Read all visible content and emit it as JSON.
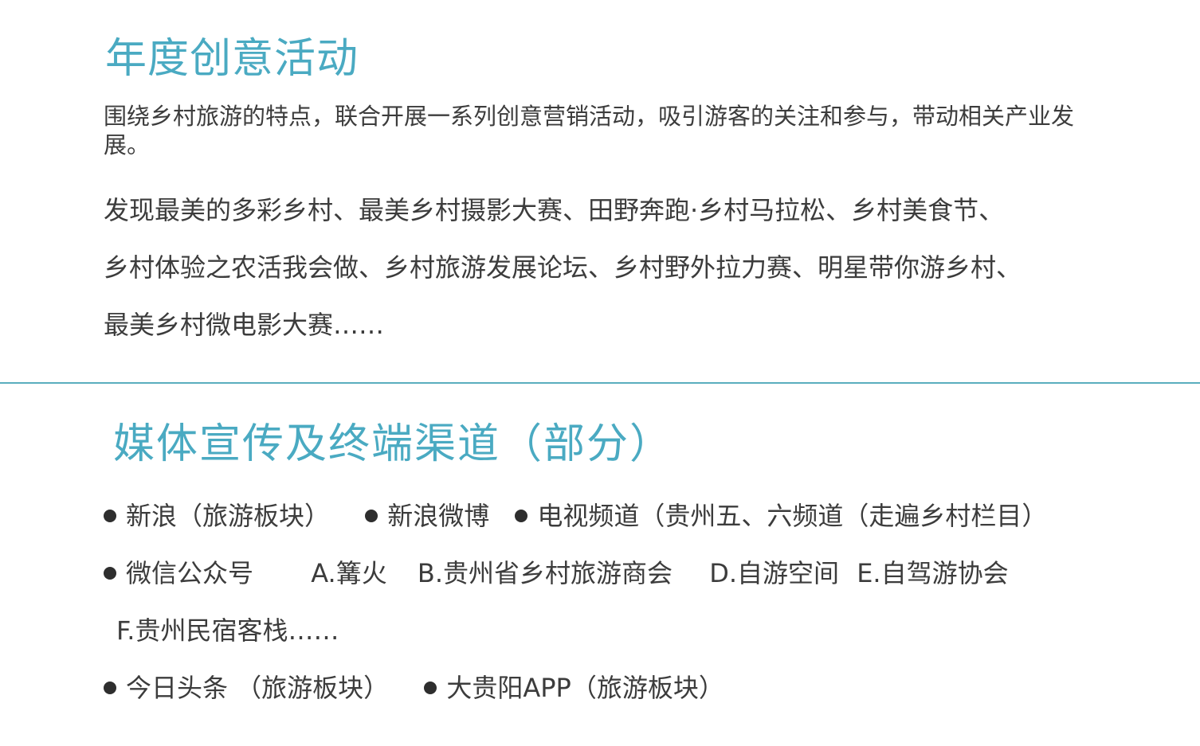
{
  "annual": {
    "title": "年度创意活动",
    "intro": "围绕乡村旅游的特点，联合开展一系列创意营销活动，吸引游客的关注和参与，带动相关产业发展。",
    "event_lines": [
      "发现最美的多彩乡村、最美乡村摄影大赛、田野奔跑·乡村马拉松、乡村美食节、",
      "乡村体验之农活我会做、乡村旅游发展论坛、乡村野外拉力赛、明星带你游乡村、",
      "最美乡村微电影大赛……"
    ]
  },
  "media": {
    "title": "媒体宣传及终端渠道（部分）",
    "line1": {
      "sina": "新浪（旅游板块）",
      "weibo": "新浪微博",
      "tv": "电视频道（贵州五、六频道（走遍乡村栏目）"
    },
    "line2": {
      "wechat": "微信公众号",
      "a": "A.篝火",
      "b": "B.贵州省乡村旅游商会",
      "d": "D.自游空间",
      "e": "E.自驾游协会"
    },
    "line3": {
      "f": "F.贵州民宿客栈……"
    },
    "line4": {
      "toutiao": "今日头条 （旅游板块）",
      "app": "大贵阳APP（旅游板块）"
    }
  }
}
